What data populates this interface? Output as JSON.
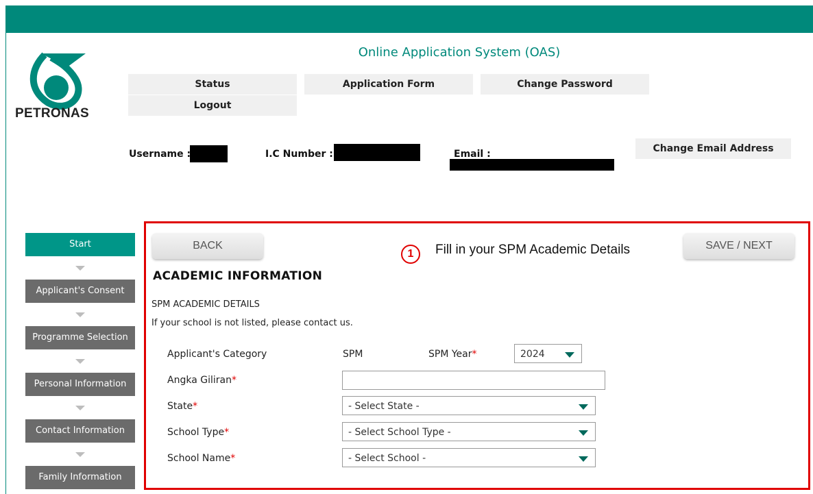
{
  "header": {
    "brand": "PETRONAS",
    "title": "Online Application System (OAS)",
    "nav": [
      "Status",
      "Application Form",
      "Change Password",
      "Logout"
    ],
    "change_email": "Change Email Address"
  },
  "user": {
    "username_label": "Username :",
    "ic_label": "I.C Number :",
    "email_label": "Email :"
  },
  "sidebar": {
    "items": [
      "Start",
      "Applicant's Consent",
      "Programme Selection",
      "Personal Information",
      "Contact Information",
      "Family Information"
    ],
    "active": "Start"
  },
  "form": {
    "back": "BACK",
    "save": "SAVE / NEXT",
    "annotation_number": "1",
    "annotation_text": "Fill in your SPM Academic Details",
    "section_title": "ACADEMIC INFORMATION",
    "subheading": "SPM ACADEMIC DETAILS",
    "note": "If your school is not listed, please contact us.",
    "category_label": "Applicant's Category",
    "category_value": "SPM",
    "spm_year_label": "SPM Year",
    "spm_year_value": "2024",
    "angka_label": "Angka Giliran",
    "angka_value": "",
    "state_label": "State",
    "state_value": "- Select State -",
    "school_type_label": "School Type",
    "school_type_value": "- Select School Type -",
    "school_name_label": "School Name",
    "school_name_value": "- Select School -",
    "required_mark": "*"
  },
  "colors": {
    "accent": "#00897b",
    "annotation": "#e00000",
    "sidebar_inactive": "#6b6b6b"
  }
}
